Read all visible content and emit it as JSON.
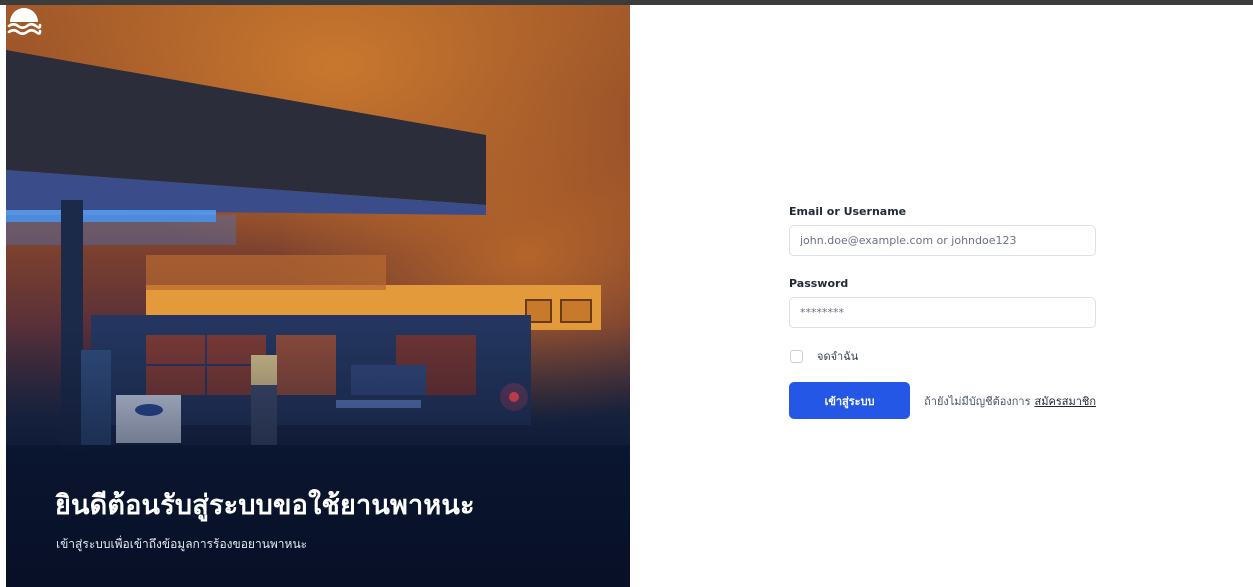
{
  "hero": {
    "logo_icon": "waves-icon",
    "title": "ยินดีต้อนรับสู่ระบบขอใช้ยานพาหนะ",
    "subtitle": "เข้าสู่ระบบเพื่อเข้าถึงข้อมูลการร้องขอยานพาหนะ"
  },
  "login_form": {
    "username_label": "Email or Username",
    "username_value": "",
    "username_placeholder": "john.doe@example.com or johndoe123",
    "password_label": "Password",
    "password_value": "",
    "password_placeholder": "********",
    "remember_label": "จดจำฉัน",
    "remember_checked": false,
    "submit_label": "เข้าสู่ระบบ",
    "signup_prompt": "ถ้ายังไม่มีบัญชีต้องการ",
    "signup_link": "สมัครสมาชิก"
  },
  "colors": {
    "primary": "#2457e6",
    "hero_dark": "#0d1a33",
    "hero_orange": "#c9782e"
  }
}
